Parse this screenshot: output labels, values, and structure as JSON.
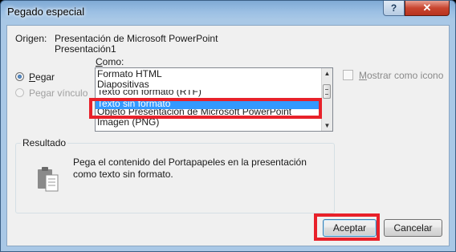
{
  "window": {
    "title": "Pegado especial",
    "help_glyph": "?",
    "close_glyph": "✕"
  },
  "origin": {
    "label": "Origen:",
    "line1": "Presentación de Microsoft PowerPoint",
    "line2": "Presentación1"
  },
  "paste_options": {
    "pegar": {
      "label": "Pegar",
      "checked": true,
      "enabled": true
    },
    "pegar_vinculo": {
      "label": "Pegar vínculo",
      "checked": false,
      "enabled": false
    }
  },
  "como": {
    "label": "Como:",
    "items": [
      "Formato HTML",
      "Diapositivas",
      "Texto con formato (RTF)",
      "Texto sin formato",
      "Objeto Presentación de Microsoft PowerPoint",
      "Imagen (PNG)"
    ],
    "selected_index": 3
  },
  "mostrar_icono": {
    "label": "Mostrar como icono",
    "checked": false,
    "enabled": false
  },
  "resultado": {
    "title": "Resultado",
    "text": "Pega el contenido del Portapapeles en la presentación como texto sin formato."
  },
  "buttons": {
    "ok": "Aceptar",
    "cancel": "Cancelar"
  },
  "colors": {
    "highlight_box": "#e8212a",
    "selection": "#3399ff",
    "title_bar": "#9cc0e4"
  }
}
